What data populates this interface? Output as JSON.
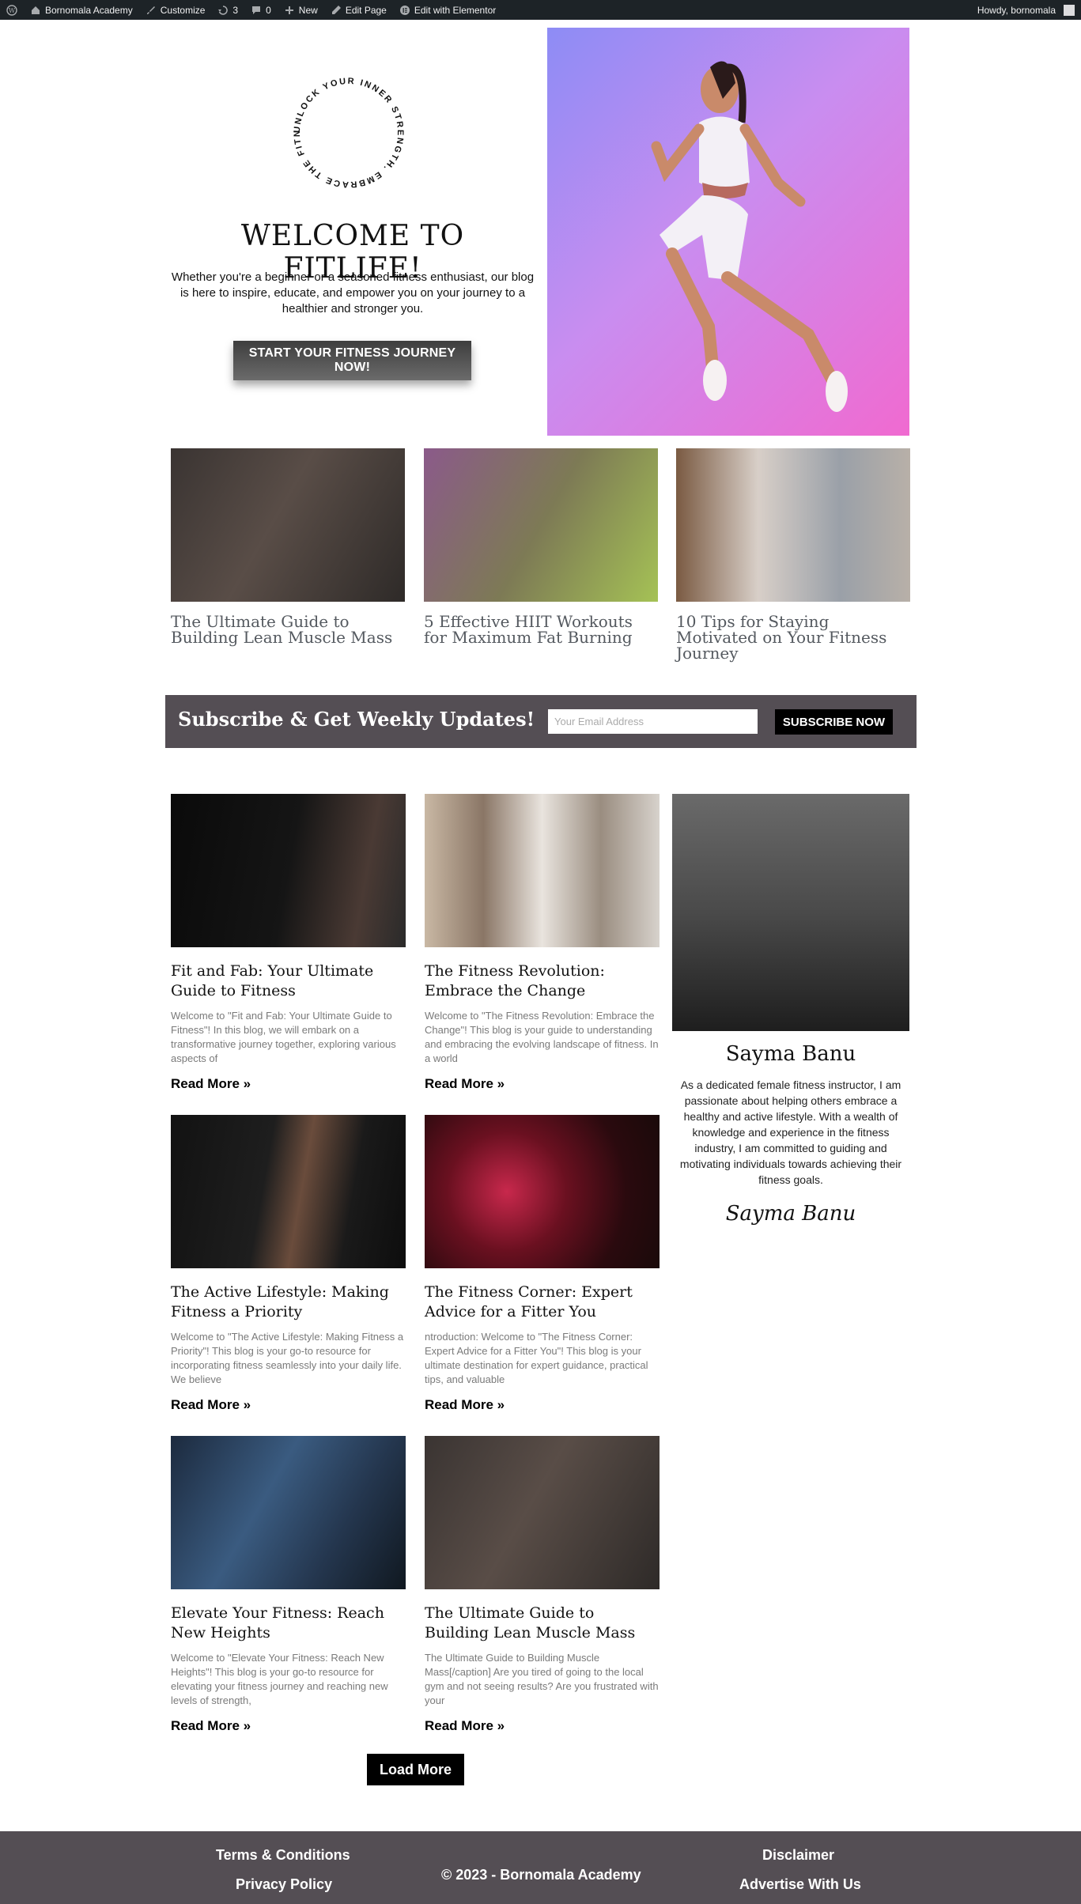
{
  "adminbar": {
    "site_name": "Bornomala Academy",
    "customize": "Customize",
    "updates": "3",
    "comments": "0",
    "new": "New",
    "edit_page": "Edit Page",
    "edit_elementor": "Edit with Elementor",
    "howdy": "Howdy, bornomala"
  },
  "hero": {
    "badge_text": "UNLOCK YOUR INNER STRENGTH. EMBRACE THE FITNESS JOURNEY!",
    "title": "WELCOME TO FITLIFE!",
    "text": "Whether you're a beginner or a seasoned fitness enthusiast, our blog is here to inspire, educate, and empower you on your journey to a healthier and stronger you.",
    "cta": "START YOUR FITNESS JOURNEY NOW!"
  },
  "featured": [
    {
      "title": "The Ultimate Guide to Building Lean Muscle Mass"
    },
    {
      "title": "5 Effective HIIT Workouts for Maximum Fat Burning"
    },
    {
      "title": "10 Tips for Staying Motivated on Your Fitness Journey"
    }
  ],
  "subscribe": {
    "title": "Subscribe & Get Weekly Updates!",
    "placeholder": "Your Email Address",
    "button": "SUBSCRIBE NOW"
  },
  "posts": [
    {
      "title": "Fit and Fab: Your Ultimate Guide to Fitness",
      "excerpt": "Welcome to \"Fit and Fab: Your Ultimate Guide to Fitness\"! In this blog, we will embark on a transformative journey together, exploring various aspects of",
      "read_more": "Read More »"
    },
    {
      "title": "The Fitness Revolution: Embrace the Change",
      "excerpt": "Welcome to \"The Fitness Revolution: Embrace the Change\"! This blog is your guide to understanding and embracing the evolving landscape of fitness. In a world",
      "read_more": "Read More »"
    },
    {
      "title": "The Active Lifestyle: Making Fitness a Priority",
      "excerpt": "Welcome to \"The Active Lifestyle: Making Fitness a Priority\"! This blog is your go-to resource for incorporating fitness seamlessly into your daily life. We believe",
      "read_more": "Read More »"
    },
    {
      "title": "The Fitness Corner: Expert Advice for a Fitter You",
      "excerpt": "ntroduction: Welcome to \"The Fitness Corner: Expert Advice for a Fitter You\"! This blog is your ultimate destination for expert guidance, practical tips, and valuable",
      "read_more": "Read More »"
    },
    {
      "title": "Elevate Your Fitness: Reach New Heights",
      "excerpt": "Welcome to \"Elevate Your Fitness: Reach New Heights\"! This blog is your go-to resource for elevating your fitness journey and reaching new levels of strength,",
      "read_more": "Read More »"
    },
    {
      "title": "The Ultimate Guide to Building Lean Muscle Mass",
      "excerpt": "The Ultimate Guide to Building Muscle Mass[/caption] Are you tired of going to the local gym and not seeing results? Are you frustrated with your",
      "read_more": "Read More »"
    }
  ],
  "load_more": "Load More",
  "author": {
    "name": "Sayma Banu",
    "bio": "As a dedicated female fitness instructor, I am passionate about helping others embrace a healthy and active lifestyle. With a wealth of knowledge and experience in the fitness industry, I am committed to guiding and motivating individuals towards achieving their fitness goals.",
    "signature": "Sayma Banu"
  },
  "footer": {
    "terms": "Terms & Conditions",
    "privacy": "Privacy Policy",
    "copyright": "© 2023 - Bornomala Academy",
    "disclaimer": "Disclaimer",
    "advertise": "Advertise With Us"
  },
  "colors": {
    "adminbar_bg": "#1d2327",
    "band_bg": "#544e54",
    "button_bg": "#000000",
    "hero_gradient": [
      "#8d8cf5",
      "#c98df0",
      "#f06ad0"
    ]
  }
}
